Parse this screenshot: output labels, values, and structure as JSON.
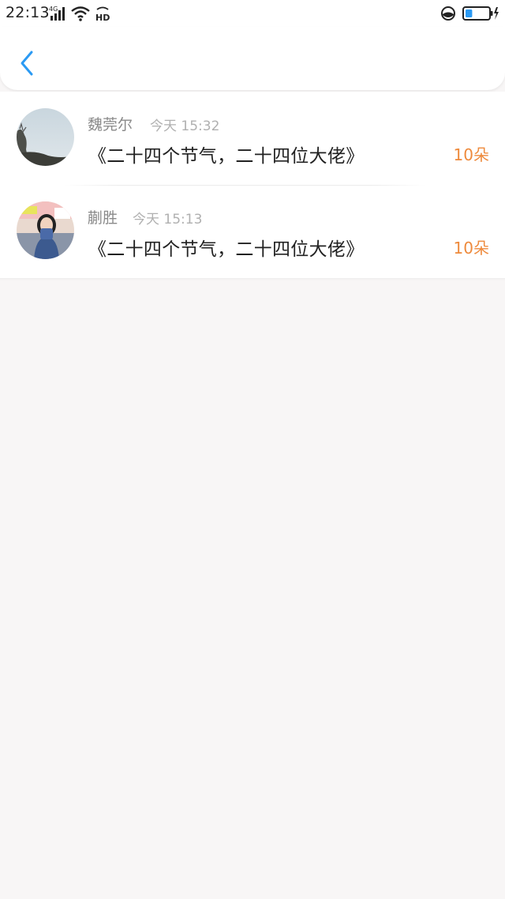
{
  "status_bar": {
    "time": "22:13",
    "network": "4G",
    "hd": "HD",
    "battery_level": 0.3
  },
  "header": {
    "back_icon": "chevron-left-icon",
    "accent_color": "#2b9af3"
  },
  "records": [
    {
      "name": "魏莞尔",
      "time": "今天 15:32",
      "title": "《二十四个节气，二十四位大佬》",
      "amount": "10朵"
    },
    {
      "name": "蒯胜",
      "time": "今天 15:13",
      "title": "《二十四个节气，二十四位大佬》",
      "amount": "10朵"
    }
  ],
  "colors": {
    "amount": "#ee8a3c",
    "background": "#f8f6f6"
  }
}
